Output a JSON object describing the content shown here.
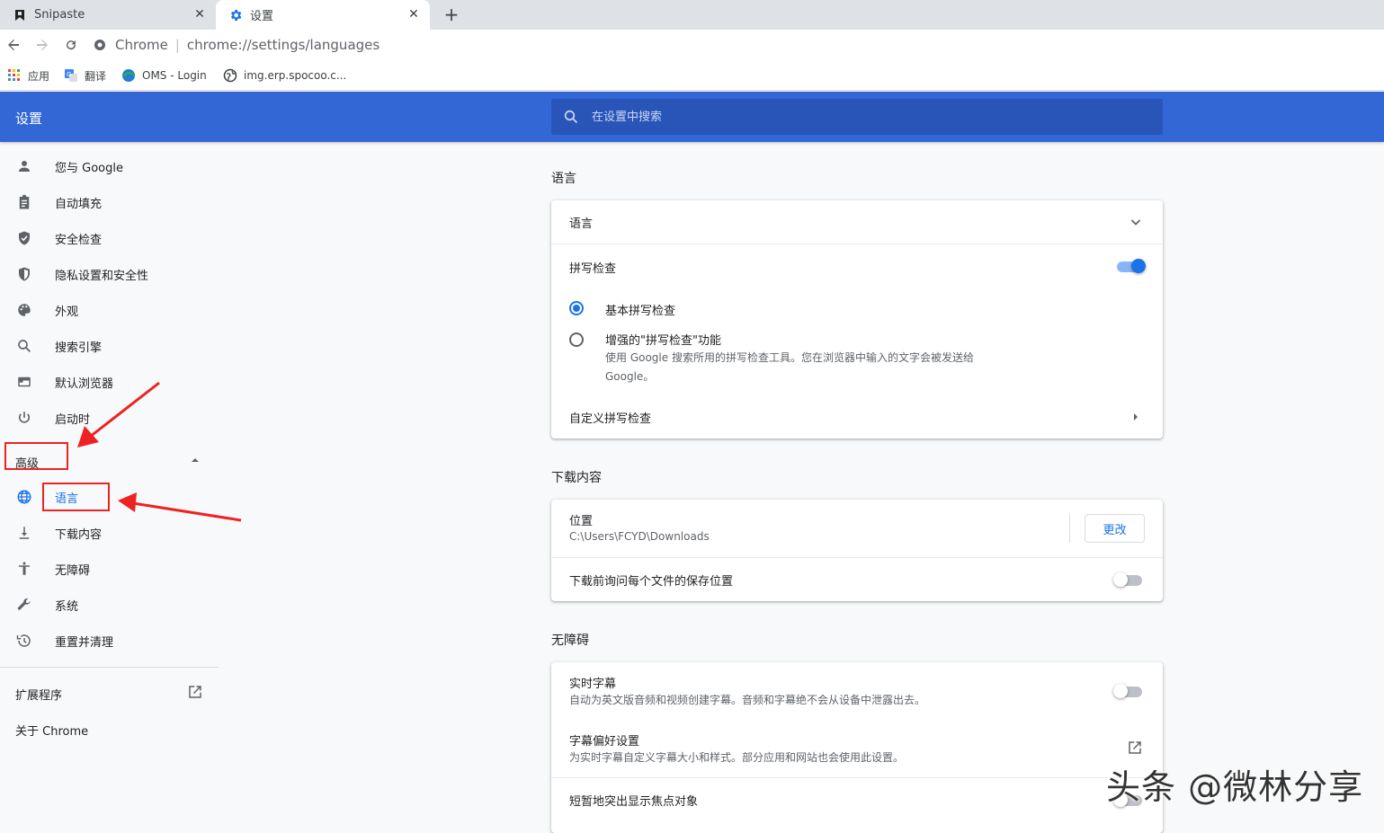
{
  "tabs": [
    {
      "label": "Snipaste",
      "icon": "snipaste-icon"
    },
    {
      "label": "设置",
      "icon": "gear-icon"
    }
  ],
  "toolbar": {
    "site_label": "Chrome",
    "url": "chrome://settings/languages"
  },
  "bookmarks": [
    {
      "label": "应用",
      "icon": "apps-grid-icon"
    },
    {
      "label": "翻译",
      "icon": "translate-icon"
    },
    {
      "label": "OMS - Login",
      "icon": "oms-icon"
    },
    {
      "label": "img.erp.spocoo.c...",
      "icon": "globe-icon"
    }
  ],
  "header": {
    "title": "设置",
    "search_placeholder": "在设置中搜索"
  },
  "sidebar": {
    "items": [
      {
        "label": "您与 Google",
        "icon": "person-icon"
      },
      {
        "label": "自动填充",
        "icon": "clipboard-icon"
      },
      {
        "label": "安全检查",
        "icon": "shield-check-icon"
      },
      {
        "label": "隐私设置和安全性",
        "icon": "shield-icon"
      },
      {
        "label": "外观",
        "icon": "palette-icon"
      },
      {
        "label": "搜索引擎",
        "icon": "search-icon"
      },
      {
        "label": "默认浏览器",
        "icon": "browser-icon"
      },
      {
        "label": "启动时",
        "icon": "power-icon"
      }
    ],
    "advanced_label": "高级",
    "advanced_items": [
      {
        "label": "语言",
        "icon": "globe-icon",
        "active": true
      },
      {
        "label": "下载内容",
        "icon": "download-icon"
      },
      {
        "label": "无障碍",
        "icon": "accessibility-icon"
      },
      {
        "label": "系统",
        "icon": "wrench-icon"
      },
      {
        "label": "重置并清理",
        "icon": "history-icon"
      }
    ],
    "extensions_label": "扩展程序",
    "about_label": "关于 Chrome"
  },
  "languages": {
    "section_title": "语言",
    "language_row": "语言",
    "spellcheck_label": "拼写检查",
    "spellcheck_enabled": true,
    "basic_label": "基本拼写检查",
    "enhanced_label": "增强的\"拼写检查\"功能",
    "enhanced_desc_1": "使用 Google 搜索所用的拼写检查工具。您在浏览器中输入的文字会被发送给",
    "enhanced_desc_2": "Google。",
    "custom_label": "自定义拼写检查"
  },
  "downloads": {
    "section_title": "下载内容",
    "location_label": "位置",
    "location_value": "C:\\Users\\FCYD\\Downloads",
    "change_button": "更改",
    "ask_label": "下载前询问每个文件的保存位置",
    "ask_enabled": false
  },
  "accessibility": {
    "section_title": "无障碍",
    "captions_label": "实时字幕",
    "captions_desc": "自动为英文版音频和视频创建字幕。音频和字幕绝不会从设备中泄露出去。",
    "captions_enabled": false,
    "caption_prefs_label": "字幕偏好设置",
    "caption_prefs_desc": "为实时字幕自定义字幕大小和样式。部分应用和网站也会使用此设置。",
    "focus_label": "短暂地突出显示焦点对象",
    "focus_enabled": false
  },
  "watermark": "头条 @微林分享",
  "colors": {
    "header_blue": "#3367d6",
    "accent": "#1a73e8",
    "annotation_red": "#ee2222"
  }
}
